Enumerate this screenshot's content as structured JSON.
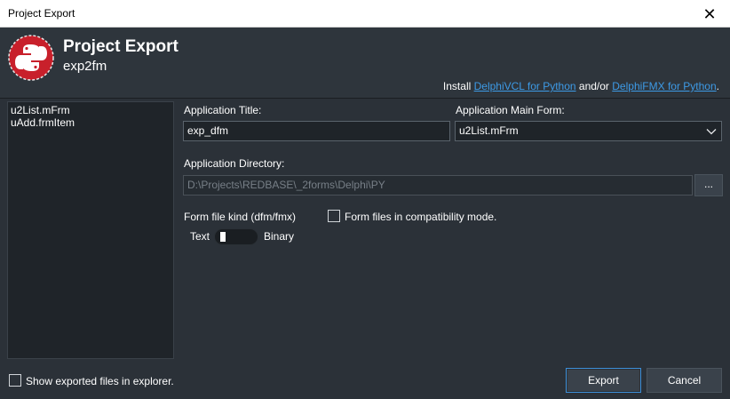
{
  "window": {
    "title": "Project Export",
    "close_glyph": "✕"
  },
  "header": {
    "title": "Project Export",
    "subtitle": "exp2fm",
    "install_prefix": "Install ",
    "link_vcl": "DelphiVCL for Python",
    "install_mid": " and/or ",
    "link_fmx": "DelphiFMX for Python",
    "install_suffix": "."
  },
  "files": [
    "u2List.mFrm",
    "uAdd.frmItem"
  ],
  "form": {
    "app_title_label": "Application Title:",
    "app_title_value": "exp_dfm",
    "main_form_label": "Application Main Form:",
    "main_form_value": "u2List.mFrm",
    "app_dir_label": "Application Directory:",
    "app_dir_value": "D:\\Projects\\REDBASE\\_2forms\\Delphi\\PY",
    "browse_label": "...",
    "form_kind_label": "Form file kind (dfm/fmx)",
    "compat_label": "Form files in compatibility mode.",
    "toggle_left": "Text",
    "toggle_right": "Binary"
  },
  "footer": {
    "show_explorer_label": "Show exported files in explorer.",
    "export_label": "Export",
    "cancel_label": "Cancel"
  },
  "icons": {
    "logo": "python-logo-icon",
    "close": "close-icon",
    "chevron": "chevron-down-icon"
  },
  "colors": {
    "background": "#2b3138",
    "link": "#3d9ae6",
    "accent": "#3d8fd8",
    "logo_red": "#c8202b"
  }
}
